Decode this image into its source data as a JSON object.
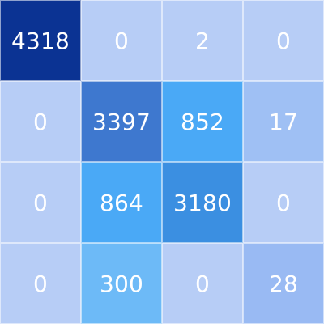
{
  "chart_data": {
    "type": "heatmap",
    "title": "",
    "xlabel": "",
    "ylabel": "",
    "grid": true,
    "legend": "none",
    "color_scale": {
      "low": "#b7cdf6",
      "mid_high": "#4aa9f6",
      "high_dark": "#3e78cf",
      "max": "#0b3393"
    },
    "values": [
      [
        4318,
        0,
        2,
        0
      ],
      [
        0,
        3397,
        852,
        17
      ],
      [
        0,
        864,
        3180,
        0
      ],
      [
        0,
        300,
        0,
        28
      ]
    ],
    "cell_colors": [
      [
        "#0b3393",
        "#b7cdf6",
        "#b7cdf6",
        "#b7cdf6"
      ],
      [
        "#b7cdf6",
        "#3e78cf",
        "#4aa9f6",
        "#9fc0f4"
      ],
      [
        "#b7cdf6",
        "#4aa9f6",
        "#3b8fe1",
        "#b7cdf6"
      ],
      [
        "#b7cdf6",
        "#6dbaf7",
        "#b7cdf6",
        "#99baf3"
      ]
    ]
  }
}
